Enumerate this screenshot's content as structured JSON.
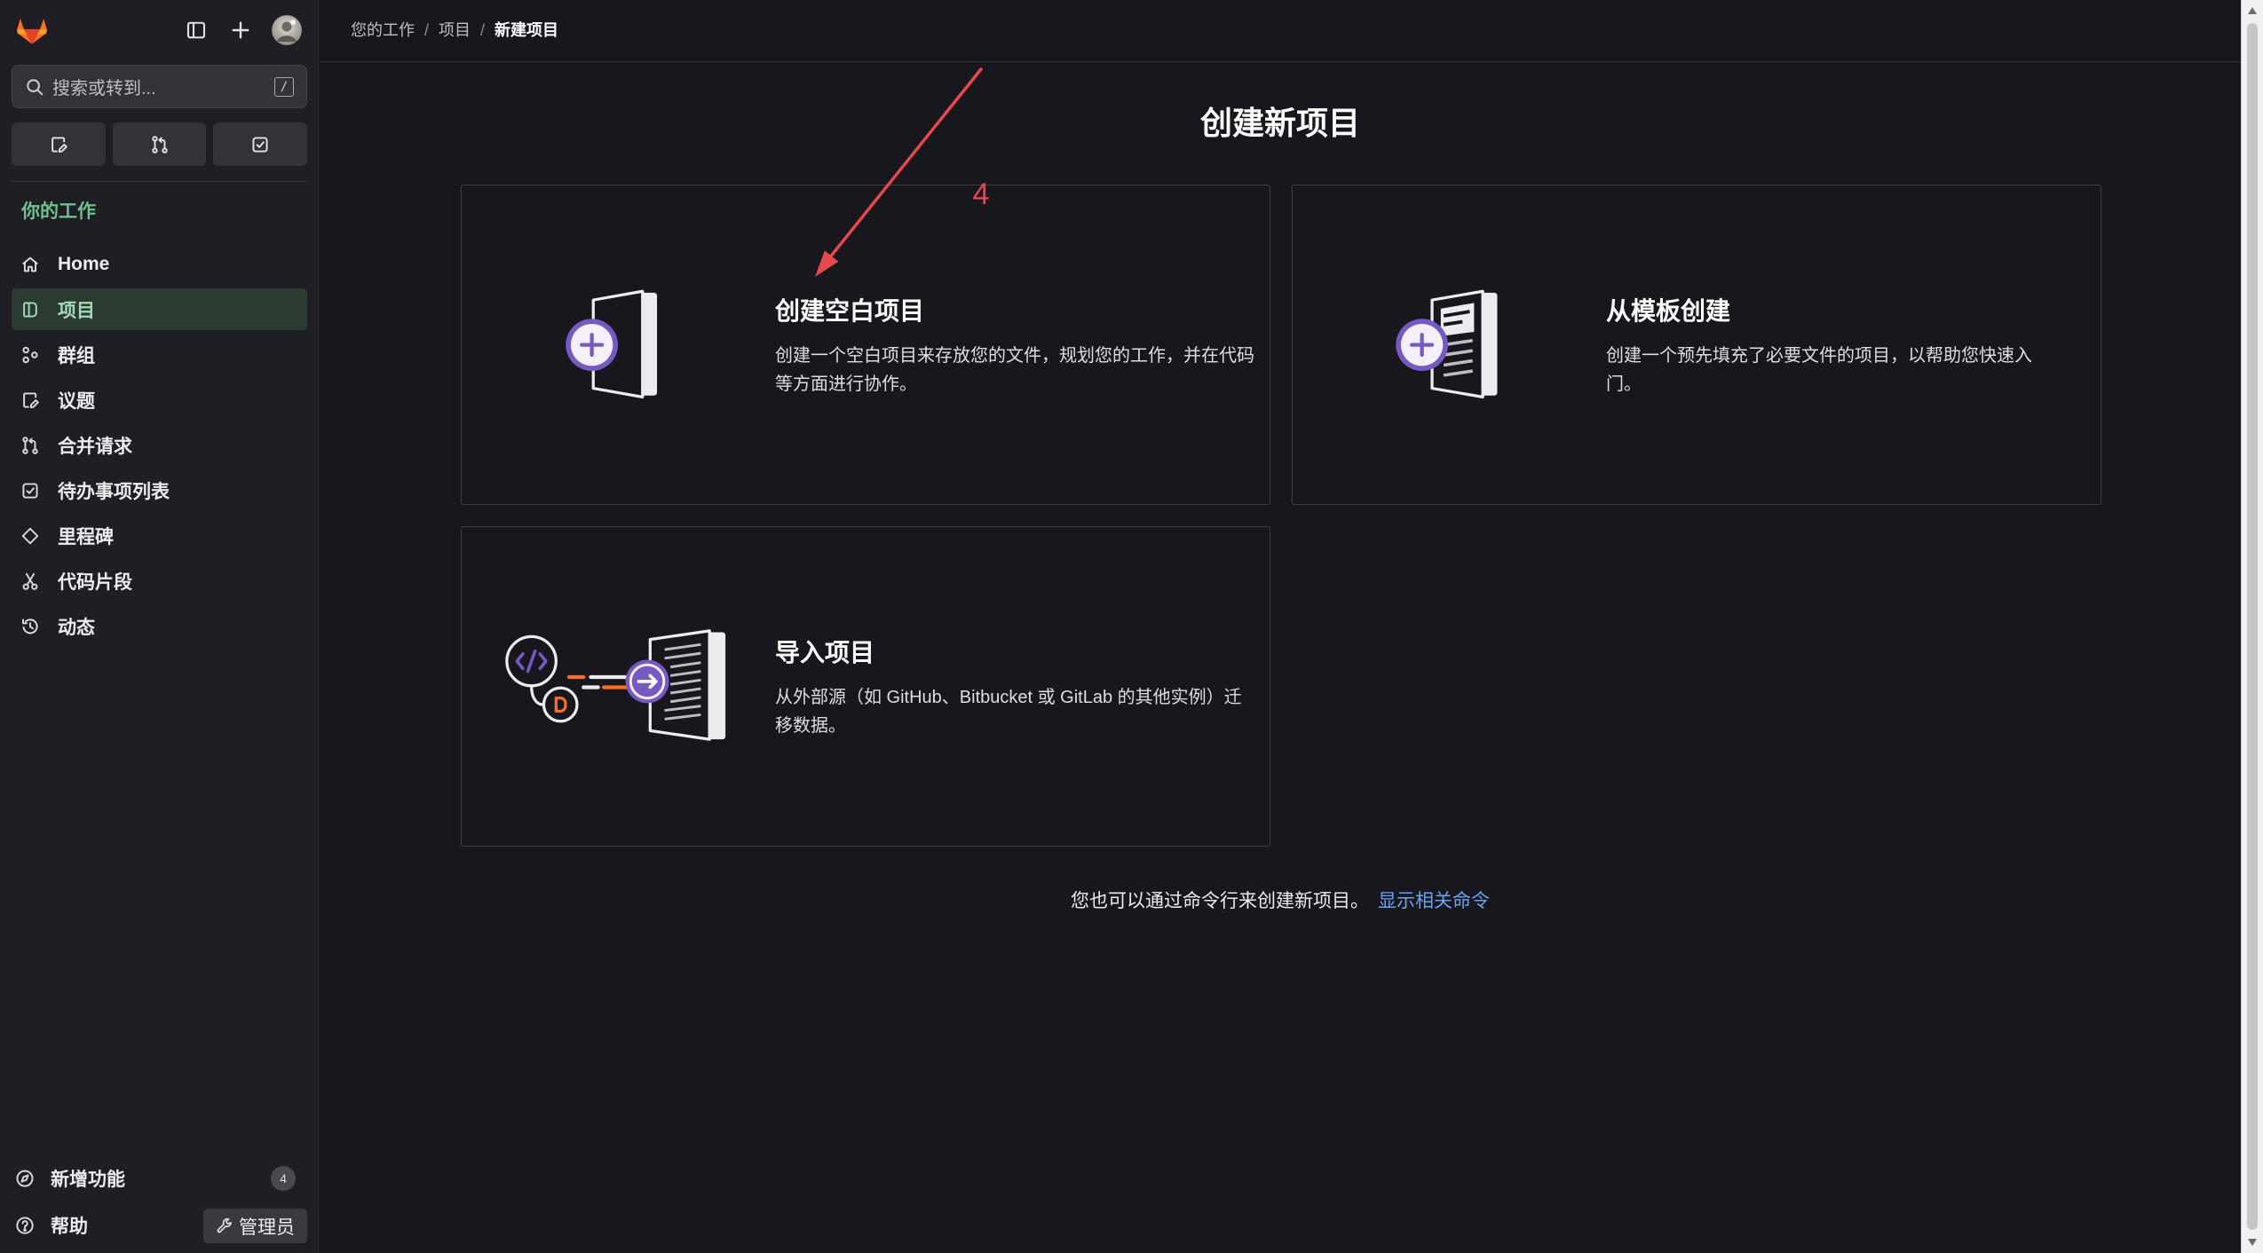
{
  "sidebar": {
    "logo_icon": "gitlab-tanuki-icon",
    "search": {
      "placeholder": "搜索或转到...",
      "shortcut": "/"
    },
    "context_title": "你的工作",
    "items": [
      {
        "label": "Home",
        "icon": "home-icon",
        "active": false
      },
      {
        "label": "项目",
        "icon": "project-icon",
        "active": true
      },
      {
        "label": "群组",
        "icon": "group-icon",
        "active": false
      },
      {
        "label": "议题",
        "icon": "issues-icon",
        "active": false
      },
      {
        "label": "合并请求",
        "icon": "merge-request-icon",
        "active": false
      },
      {
        "label": "待办事项列表",
        "icon": "todo-icon",
        "active": false
      },
      {
        "label": "里程碑",
        "icon": "milestone-icon",
        "active": false
      },
      {
        "label": "代码片段",
        "icon": "snippet-icon",
        "active": false
      },
      {
        "label": "动态",
        "icon": "activity-icon",
        "active": false
      }
    ],
    "whats_new": {
      "label": "新增功能",
      "count": "4"
    },
    "help": {
      "label": "帮助"
    },
    "admin": {
      "label": "管理员"
    }
  },
  "breadcrumb": [
    "您的工作",
    "项目",
    "新建项目"
  ],
  "page": {
    "title": "创建新项目"
  },
  "cards": [
    {
      "title": "创建空白项目",
      "description": "创建一个空白项目来存放您的文件，规划您的工作，并在代码等方面进行协作。",
      "icon": "blank-project-illustration"
    },
    {
      "title": "从模板创建",
      "description": "创建一个预先填充了必要文件的项目，以帮助您快速入门。",
      "icon": "template-project-illustration"
    },
    {
      "title": "导入项目",
      "description": "从外部源（如 GitHub、Bitbucket 或 GitLab 的其他实例）迁移数据。",
      "icon": "import-project-illustration"
    }
  ],
  "footer": {
    "text": "您也可以通过命令行来创建新项目。",
    "link": "显示相关命令"
  },
  "annotation": {
    "label": "4",
    "color": "#e5484d"
  },
  "colors": {
    "accent_purple": "#7759c2",
    "gitlab_orange": "#fc6d26",
    "link_blue": "#6aa4f0",
    "active_green": "#a3dbb6"
  }
}
